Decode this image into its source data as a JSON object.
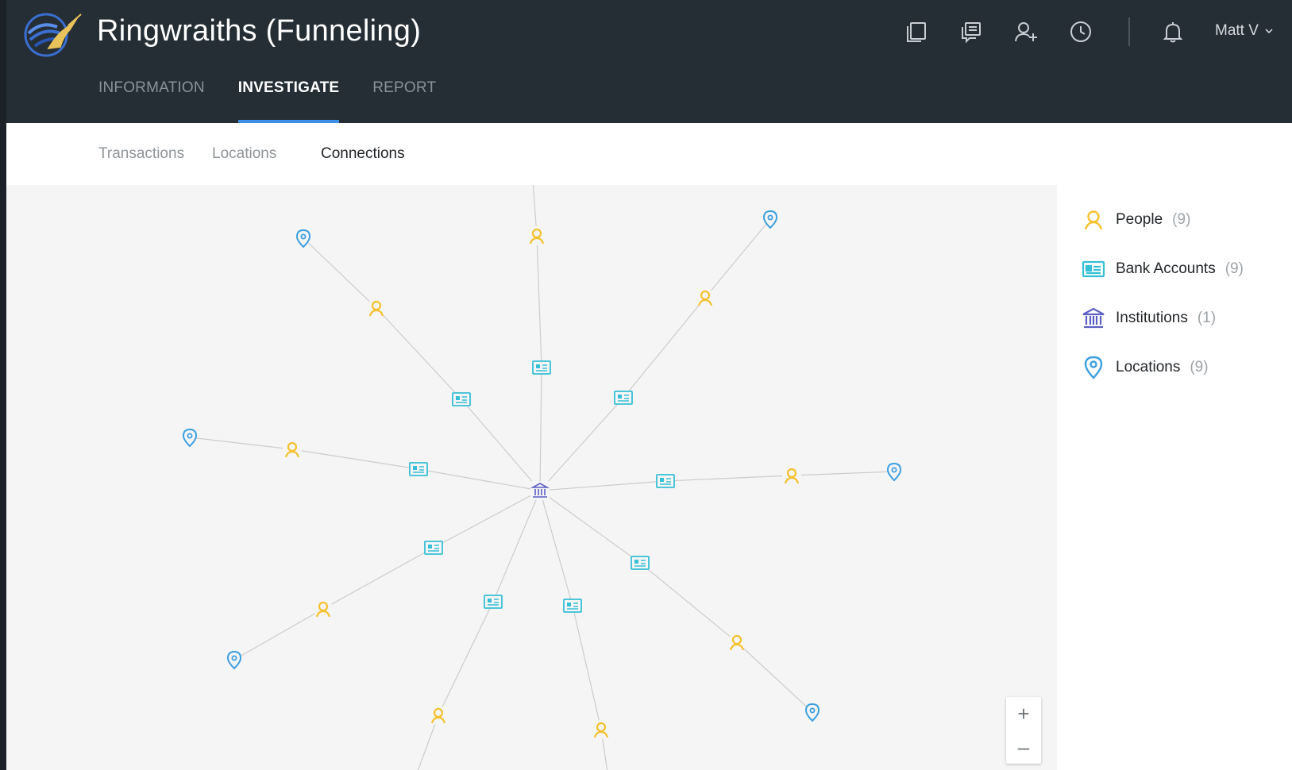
{
  "app": {
    "title": "Ringwraiths (Funneling)"
  },
  "header": {
    "icons": [
      "copy-icon",
      "comments-icon",
      "add-user-icon",
      "history-icon",
      "bell-icon"
    ],
    "user": "Matt V"
  },
  "tabs": [
    {
      "label": "INFORMATION",
      "active": false
    },
    {
      "label": "INVESTIGATE",
      "active": true
    },
    {
      "label": "REPORT",
      "active": false
    }
  ],
  "subtabs": [
    {
      "label": "Transactions",
      "active": false
    },
    {
      "label": "Locations",
      "active": false
    },
    {
      "label": "Connections",
      "active": true
    }
  ],
  "legend": [
    {
      "label": "People",
      "count": "(9)",
      "icon": "person-icon",
      "color": "#f5c12e"
    },
    {
      "label": "Bank Accounts",
      "count": "(9)",
      "icon": "bank-account-icon",
      "color": "#36bfd6"
    },
    {
      "label": "Institutions",
      "count": "(1)",
      "icon": "institution-icon",
      "color": "#5b5fc4"
    },
    {
      "label": "Locations",
      "count": "(9)",
      "icon": "location-pin-icon",
      "color": "#3d9fe0"
    }
  ],
  "zoom": {
    "in": "+",
    "out": "–"
  },
  "colors": {
    "header_bg": "#252d35",
    "tab_accent": "#3e8ee8",
    "person": "#f5c12e",
    "account": "#36bfd6",
    "institution": "#5b5fc4",
    "location": "#3d9fe0",
    "edge": "#cccccc"
  }
}
